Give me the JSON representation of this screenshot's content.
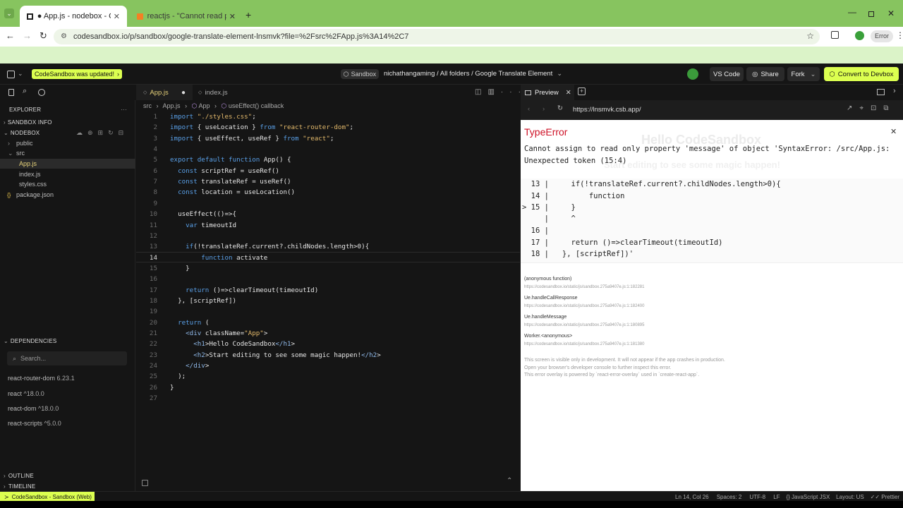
{
  "browser": {
    "tabs": [
      {
        "title": "● App.js - nodebox - CodeSand"
      },
      {
        "title": "reactjs - \"Cannot read propert"
      }
    ],
    "url": "codesandbox.io/p/sandbox/google-translate-element-lnsmvk?file=%2Fsrc%2FApp.js%3A14%2C7",
    "error_button": "Error"
  },
  "csb": {
    "update_badge": "CodeSandbox was updated!",
    "sandbox_label": "Sandbox",
    "breadcrumb": "nichathangaming / All folders / Google Translate Element",
    "vscode_button": "VS Code",
    "share_button": "Share",
    "fork_button": "Fork",
    "devbox_button": "Convert to Devbox"
  },
  "sidebar": {
    "explorer": "EXPLORER",
    "sandbox_info": "SANDBOX INFO",
    "nodebox": "NODEBOX",
    "files": [
      {
        "name": "public",
        "icon": "›"
      },
      {
        "name": "src",
        "icon": "⌄"
      },
      {
        "name": "App.js",
        "icon": ""
      },
      {
        "name": "index.js",
        "icon": ""
      },
      {
        "name": "styles.css",
        "icon": ""
      },
      {
        "name": "package.json",
        "icon": "{}"
      }
    ],
    "dependencies": "DEPENDENCIES",
    "search_placeholder": "Search...",
    "deps": [
      {
        "name": "react-router-dom",
        "version": "6.23.1"
      },
      {
        "name": "react",
        "version": "^18.0.0"
      },
      {
        "name": "react-dom",
        "version": "^18.0.0"
      },
      {
        "name": "react-scripts",
        "version": "^5.0.0"
      }
    ],
    "outline": "OUTLINE",
    "timeline": "TIMELINE"
  },
  "editor": {
    "tabs": [
      "App.js",
      "index.js"
    ],
    "breadcrumb": [
      "src",
      "App.js",
      "App",
      "useEffect() callback"
    ],
    "lines": [
      {
        "n": "1",
        "t": "import \"./styles.css\";"
      },
      {
        "n": "2",
        "t": "import { useLocation } from \"react-router-dom\";"
      },
      {
        "n": "3",
        "t": "import { useEffect, useRef } from \"react\";"
      },
      {
        "n": "4",
        "t": ""
      },
      {
        "n": "5",
        "t": "export default function App() {"
      },
      {
        "n": "6",
        "t": "  const scriptRef = useRef()"
      },
      {
        "n": "7",
        "t": "  const translateRef = useRef()"
      },
      {
        "n": "8",
        "t": "  const location = useLocation()"
      },
      {
        "n": "9",
        "t": ""
      },
      {
        "n": "10",
        "t": "  useEffect(()=>{"
      },
      {
        "n": "11",
        "t": "    var timeoutId"
      },
      {
        "n": "12",
        "t": ""
      },
      {
        "n": "13",
        "t": "    if(!translateRef.current?.childNodes.length>0){"
      },
      {
        "n": "14",
        "t": "        function activate"
      },
      {
        "n": "15",
        "t": "    }"
      },
      {
        "n": "16",
        "t": ""
      },
      {
        "n": "17",
        "t": "    return ()=>clearTimeout(timeoutId)"
      },
      {
        "n": "18",
        "t": "  }, [scriptRef])"
      },
      {
        "n": "19",
        "t": ""
      },
      {
        "n": "20",
        "t": "  return ("
      },
      {
        "n": "21",
        "t": "    <div className=\"App\">"
      },
      {
        "n": "22",
        "t": "      <h1>Hello CodeSandbox</h1>"
      },
      {
        "n": "23",
        "t": "      <h2>Start editing to see some magic happen!</h2>"
      },
      {
        "n": "24",
        "t": "    </div>"
      },
      {
        "n": "25",
        "t": "  );"
      },
      {
        "n": "26",
        "t": "}"
      },
      {
        "n": "27",
        "t": ""
      }
    ]
  },
  "preview": {
    "tab": "Preview",
    "url": "https://lnsmvk.csb.app/",
    "bg_title": "Hello CodeSandbox",
    "bg_subtitle": "Start editing to see some magic happen!",
    "error_type": "TypeError",
    "error_message_1": "Cannot assign to read only property 'message' of object 'SyntaxError: /src/App.js:",
    "error_message_2": "Unexpected token (15:4)",
    "snippet": [
      {
        "t": "  13 |     if(!translateRef.current?.childNodes.length>0){"
      },
      {
        "t": "  14 |         function"
      },
      {
        "t": "> 15 |     }"
      },
      {
        "t": "     |     ^"
      },
      {
        "t": "  16 |"
      },
      {
        "t": "  17 |     return ()=>clearTimeout(timeoutId)"
      },
      {
        "t": "  18 |   }, [scriptRef])'"
      }
    ],
    "stack": [
      {
        "fn": "(anonymous function)",
        "url": "https://codesandbox.io/static/js/sandbox.275a9407e.js:1:182281"
      },
      {
        "fn": "Ue.handleCallResponse",
        "url": "https://codesandbox.io/static/js/sandbox.275a9407e.js:1:182400"
      },
      {
        "fn": "Ue.handleMessage",
        "url": "https://codesandbox.io/static/js/sandbox.275a9407e.js:1:180895"
      },
      {
        "fn": "Worker.<anonymous>",
        "url": "https://codesandbox.io/static/js/sandbox.275a9407e.js:1:181380"
      }
    ],
    "footer_1": "This screen is visible only in development. It will not appear if the app crashes in production.",
    "footer_2": "Open your browser's developer console to further inspect this error.",
    "footer_3": "This error overlay is powered by `react-error-overlay` used in `create-react-app`."
  },
  "status": {
    "left": "CodeSandbox - Sandbox (Web)",
    "position": "Ln 14, Col 26",
    "spaces": "Spaces: 2",
    "encoding": "UTF-8",
    "eol": "LF",
    "language": "JavaScript JSX",
    "layout": "Layout: US",
    "prettier": "Prettier"
  },
  "colors": {
    "accent": "#dcff50",
    "error": "#ce1126",
    "browser_green": "#87c45f"
  }
}
